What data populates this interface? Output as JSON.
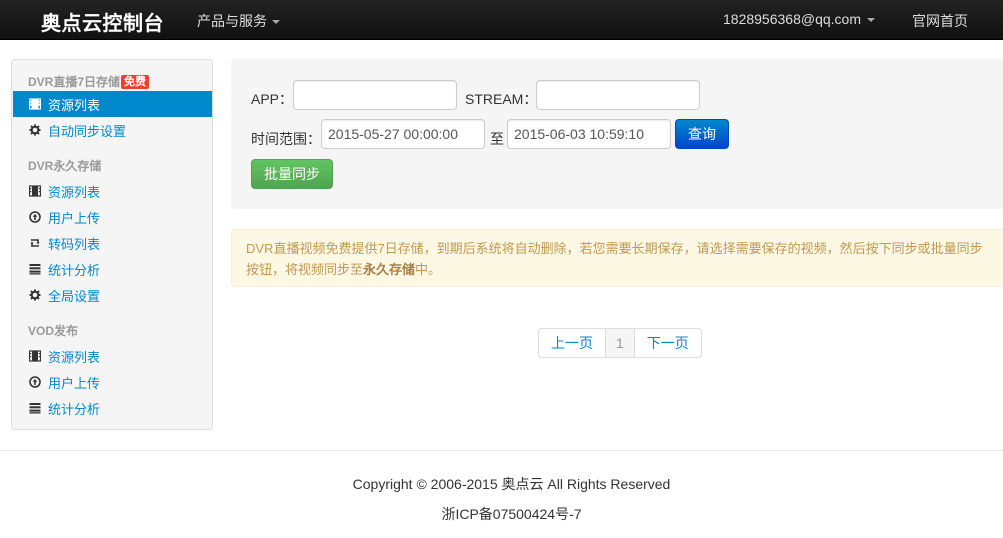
{
  "navbar": {
    "brand": "奥点云控制台",
    "products": "产品与服务",
    "user": "1828956368@qq.com",
    "home": "官网首页"
  },
  "sidebar": {
    "sections": [
      {
        "header": "DVR直播7日存储",
        "badge": "免费",
        "items": [
          {
            "label": "资源列表",
            "icon": "film-icon",
            "active": true
          },
          {
            "label": "自动同步设置",
            "icon": "gear-icon",
            "active": false
          }
        ]
      },
      {
        "header": "DVR永久存储",
        "items": [
          {
            "label": "资源列表",
            "icon": "film-icon"
          },
          {
            "label": "用户上传",
            "icon": "upload-circle-icon"
          },
          {
            "label": "转码列表",
            "icon": "retweet-icon"
          },
          {
            "label": "统计分析",
            "icon": "list-icon"
          },
          {
            "label": "全局设置",
            "icon": "gear-icon"
          }
        ]
      },
      {
        "header": "VOD发布",
        "items": [
          {
            "label": "资源列表",
            "icon": "film-icon"
          },
          {
            "label": "用户上传",
            "icon": "upload-circle-icon"
          },
          {
            "label": "统计分析",
            "icon": "list-icon"
          }
        ]
      }
    ]
  },
  "search": {
    "app_label": "APP：",
    "app_value": "",
    "stream_label": "STREAM：",
    "stream_value": "",
    "time_label": "时间范围：",
    "start_time": "2015-05-27 00:00:00",
    "to_label": "至",
    "end_time": "2015-06-03 10:59:10",
    "query_button": "查询",
    "batch_sync_button": "批量同步"
  },
  "alert": {
    "text_before": "DVR直播视频免费提供7日存储，到期后系统将自动删除，若您需要长期保存，请选择需要保存的视频，然后按下同步或批量同步按钮，将视频同步至",
    "text_bold": "永久存储",
    "text_after": "中。"
  },
  "pagination": {
    "prev": "上一页",
    "current": "1",
    "next": "下一页"
  },
  "footer": {
    "copyright": "Copyright © 2006-2015 奥点云 All Rights Reserved",
    "icp": "浙ICP备07500424号-7"
  },
  "colors": {
    "link": "#0088cc",
    "active_bg": "#0088cc",
    "query_button": "#0055cc",
    "sync_button": "#5bb75b",
    "alert_bg": "#fcf8e3",
    "alert_text": "#c09853",
    "badge": "#f0402d"
  }
}
